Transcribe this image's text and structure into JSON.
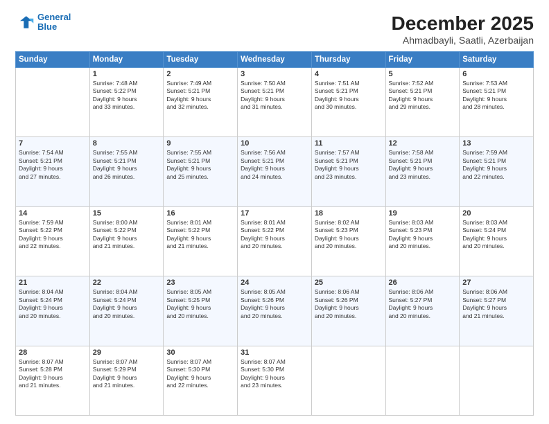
{
  "header": {
    "logo_line1": "General",
    "logo_line2": "Blue",
    "title": "December 2025",
    "subtitle": "Ahmadbayli, Saatli, Azerbaijan"
  },
  "weekdays": [
    "Sunday",
    "Monday",
    "Tuesday",
    "Wednesday",
    "Thursday",
    "Friday",
    "Saturday"
  ],
  "weeks": [
    [
      {
        "day": "",
        "info": ""
      },
      {
        "day": "1",
        "info": "Sunrise: 7:48 AM\nSunset: 5:22 PM\nDaylight: 9 hours\nand 33 minutes."
      },
      {
        "day": "2",
        "info": "Sunrise: 7:49 AM\nSunset: 5:21 PM\nDaylight: 9 hours\nand 32 minutes."
      },
      {
        "day": "3",
        "info": "Sunrise: 7:50 AM\nSunset: 5:21 PM\nDaylight: 9 hours\nand 31 minutes."
      },
      {
        "day": "4",
        "info": "Sunrise: 7:51 AM\nSunset: 5:21 PM\nDaylight: 9 hours\nand 30 minutes."
      },
      {
        "day": "5",
        "info": "Sunrise: 7:52 AM\nSunset: 5:21 PM\nDaylight: 9 hours\nand 29 minutes."
      },
      {
        "day": "6",
        "info": "Sunrise: 7:53 AM\nSunset: 5:21 PM\nDaylight: 9 hours\nand 28 minutes."
      }
    ],
    [
      {
        "day": "7",
        "info": "Sunrise: 7:54 AM\nSunset: 5:21 PM\nDaylight: 9 hours\nand 27 minutes."
      },
      {
        "day": "8",
        "info": "Sunrise: 7:55 AM\nSunset: 5:21 PM\nDaylight: 9 hours\nand 26 minutes."
      },
      {
        "day": "9",
        "info": "Sunrise: 7:55 AM\nSunset: 5:21 PM\nDaylight: 9 hours\nand 25 minutes."
      },
      {
        "day": "10",
        "info": "Sunrise: 7:56 AM\nSunset: 5:21 PM\nDaylight: 9 hours\nand 24 minutes."
      },
      {
        "day": "11",
        "info": "Sunrise: 7:57 AM\nSunset: 5:21 PM\nDaylight: 9 hours\nand 23 minutes."
      },
      {
        "day": "12",
        "info": "Sunrise: 7:58 AM\nSunset: 5:21 PM\nDaylight: 9 hours\nand 23 minutes."
      },
      {
        "day": "13",
        "info": "Sunrise: 7:59 AM\nSunset: 5:21 PM\nDaylight: 9 hours\nand 22 minutes."
      }
    ],
    [
      {
        "day": "14",
        "info": "Sunrise: 7:59 AM\nSunset: 5:22 PM\nDaylight: 9 hours\nand 22 minutes."
      },
      {
        "day": "15",
        "info": "Sunrise: 8:00 AM\nSunset: 5:22 PM\nDaylight: 9 hours\nand 21 minutes."
      },
      {
        "day": "16",
        "info": "Sunrise: 8:01 AM\nSunset: 5:22 PM\nDaylight: 9 hours\nand 21 minutes."
      },
      {
        "day": "17",
        "info": "Sunrise: 8:01 AM\nSunset: 5:22 PM\nDaylight: 9 hours\nand 20 minutes."
      },
      {
        "day": "18",
        "info": "Sunrise: 8:02 AM\nSunset: 5:23 PM\nDaylight: 9 hours\nand 20 minutes."
      },
      {
        "day": "19",
        "info": "Sunrise: 8:03 AM\nSunset: 5:23 PM\nDaylight: 9 hours\nand 20 minutes."
      },
      {
        "day": "20",
        "info": "Sunrise: 8:03 AM\nSunset: 5:24 PM\nDaylight: 9 hours\nand 20 minutes."
      }
    ],
    [
      {
        "day": "21",
        "info": "Sunrise: 8:04 AM\nSunset: 5:24 PM\nDaylight: 9 hours\nand 20 minutes."
      },
      {
        "day": "22",
        "info": "Sunrise: 8:04 AM\nSunset: 5:24 PM\nDaylight: 9 hours\nand 20 minutes."
      },
      {
        "day": "23",
        "info": "Sunrise: 8:05 AM\nSunset: 5:25 PM\nDaylight: 9 hours\nand 20 minutes."
      },
      {
        "day": "24",
        "info": "Sunrise: 8:05 AM\nSunset: 5:26 PM\nDaylight: 9 hours\nand 20 minutes."
      },
      {
        "day": "25",
        "info": "Sunrise: 8:06 AM\nSunset: 5:26 PM\nDaylight: 9 hours\nand 20 minutes."
      },
      {
        "day": "26",
        "info": "Sunrise: 8:06 AM\nSunset: 5:27 PM\nDaylight: 9 hours\nand 20 minutes."
      },
      {
        "day": "27",
        "info": "Sunrise: 8:06 AM\nSunset: 5:27 PM\nDaylight: 9 hours\nand 21 minutes."
      }
    ],
    [
      {
        "day": "28",
        "info": "Sunrise: 8:07 AM\nSunset: 5:28 PM\nDaylight: 9 hours\nand 21 minutes."
      },
      {
        "day": "29",
        "info": "Sunrise: 8:07 AM\nSunset: 5:29 PM\nDaylight: 9 hours\nand 21 minutes."
      },
      {
        "day": "30",
        "info": "Sunrise: 8:07 AM\nSunset: 5:30 PM\nDaylight: 9 hours\nand 22 minutes."
      },
      {
        "day": "31",
        "info": "Sunrise: 8:07 AM\nSunset: 5:30 PM\nDaylight: 9 hours\nand 23 minutes."
      },
      {
        "day": "",
        "info": ""
      },
      {
        "day": "",
        "info": ""
      },
      {
        "day": "",
        "info": ""
      }
    ]
  ]
}
